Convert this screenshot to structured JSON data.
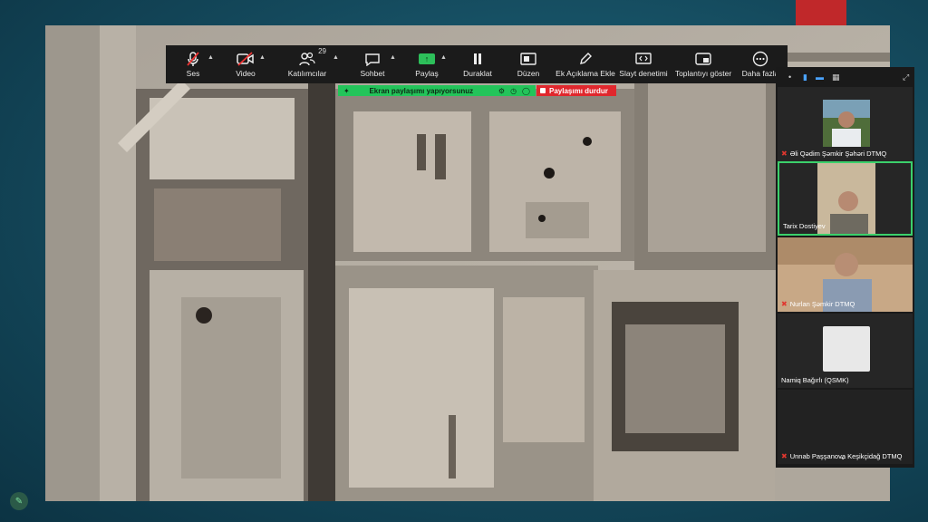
{
  "toolbar": {
    "items": [
      {
        "label": "Ses",
        "icon": "mic-muted-icon"
      },
      {
        "label": "Video",
        "icon": "video-off-icon"
      },
      {
        "label": "Katılımcılar",
        "icon": "participants-icon",
        "count": "29"
      },
      {
        "label": "Sohbet",
        "icon": "chat-icon"
      },
      {
        "label": "Paylaş",
        "icon": "share-screen-icon"
      },
      {
        "label": "Duraklat",
        "icon": "pause-icon"
      },
      {
        "label": "Düzen",
        "icon": "annotate-icon"
      },
      {
        "label": "Ek Açıklama Ekle",
        "icon": "pencil-icon"
      },
      {
        "label": "Slayt denetimi",
        "icon": "slide-control-icon"
      },
      {
        "label": "Toplantıyı göster",
        "icon": "show-meeting-icon"
      },
      {
        "label": "Daha fazla",
        "icon": "more-icon"
      }
    ]
  },
  "share_status": {
    "text": "Ekran paylaşımı yapıyorsunuz",
    "stop_label": "Paylaşımı durdur"
  },
  "participants": [
    {
      "name": "Əli Qədim Şəmkir Şəhəri DTMQ",
      "muted": true
    },
    {
      "name": "Tarix Dostiyev",
      "muted": false
    },
    {
      "name": "Nurlan Şəmkir DTMQ",
      "muted": true
    },
    {
      "name": "Namiq Bağırlı (QSMK)",
      "muted": false
    },
    {
      "name": "Unnab Paşşanova Keşikçidağ DTMQ",
      "muted": true
    }
  ],
  "colors": {
    "share_green": "#23c45a",
    "stop_red": "#e0272d",
    "active_speaker": "#3bd06b"
  }
}
